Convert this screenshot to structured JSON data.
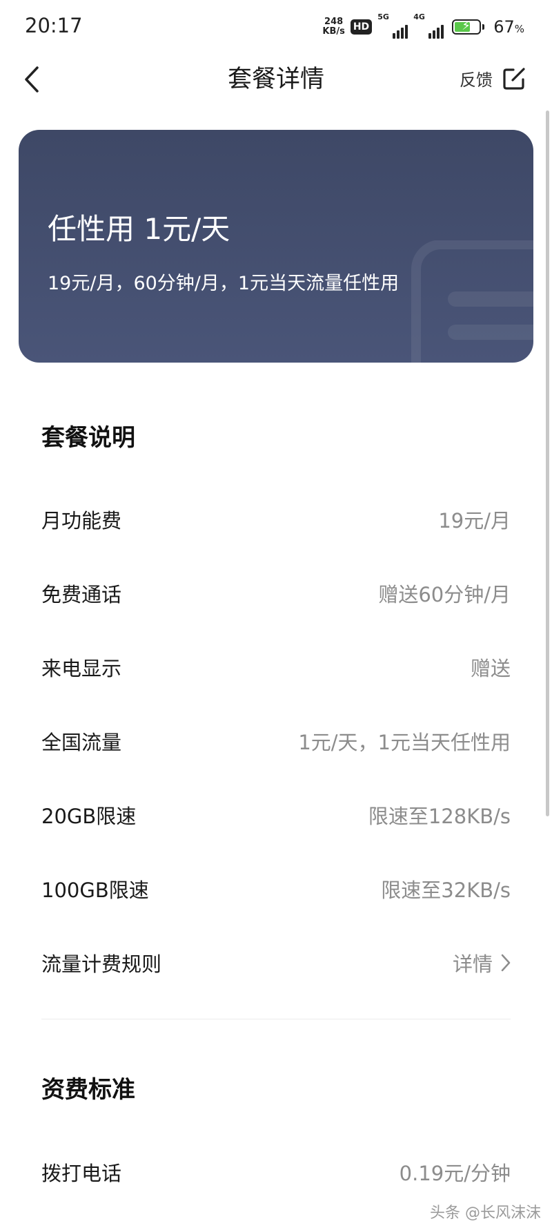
{
  "status": {
    "time": "20:17",
    "net_speed_value": "248",
    "net_speed_unit": "KB/s",
    "hd_label": "HD",
    "sim1_network": "5G",
    "sim2_network": "4G",
    "battery_percent": "67",
    "battery_unit": "%",
    "battery_level": 0.67
  },
  "header": {
    "title": "套餐详情",
    "feedback_label": "反馈"
  },
  "plan": {
    "name": "任性用 1元/天",
    "description": "19元/月，60分钟/月，1元当天流量任性用"
  },
  "sections": {
    "plan_info": {
      "title": "套餐说明",
      "rows": [
        {
          "label": "月功能费",
          "value": "19元/月"
        },
        {
          "label": "免费通话",
          "value": "赠送60分钟/月"
        },
        {
          "label": "来电显示",
          "value": "赠送"
        },
        {
          "label": "全国流量",
          "value": "1元/天，1元当天任性用"
        },
        {
          "label": "20GB限速",
          "value": "限速至128KB/s"
        },
        {
          "label": "100GB限速",
          "value": "限速至32KB/s"
        },
        {
          "label": "流量计费规则",
          "value": "详情"
        }
      ]
    },
    "tariff": {
      "title": "资费标准",
      "rows": [
        {
          "label": "拨打电话",
          "value": "0.19元/分钟"
        }
      ]
    }
  },
  "watermark": "头条 @长风沫沫",
  "colors": {
    "card_background": "#434e6e",
    "value_text": "#8c8c8c",
    "battery_fill": "#5ac84a"
  }
}
